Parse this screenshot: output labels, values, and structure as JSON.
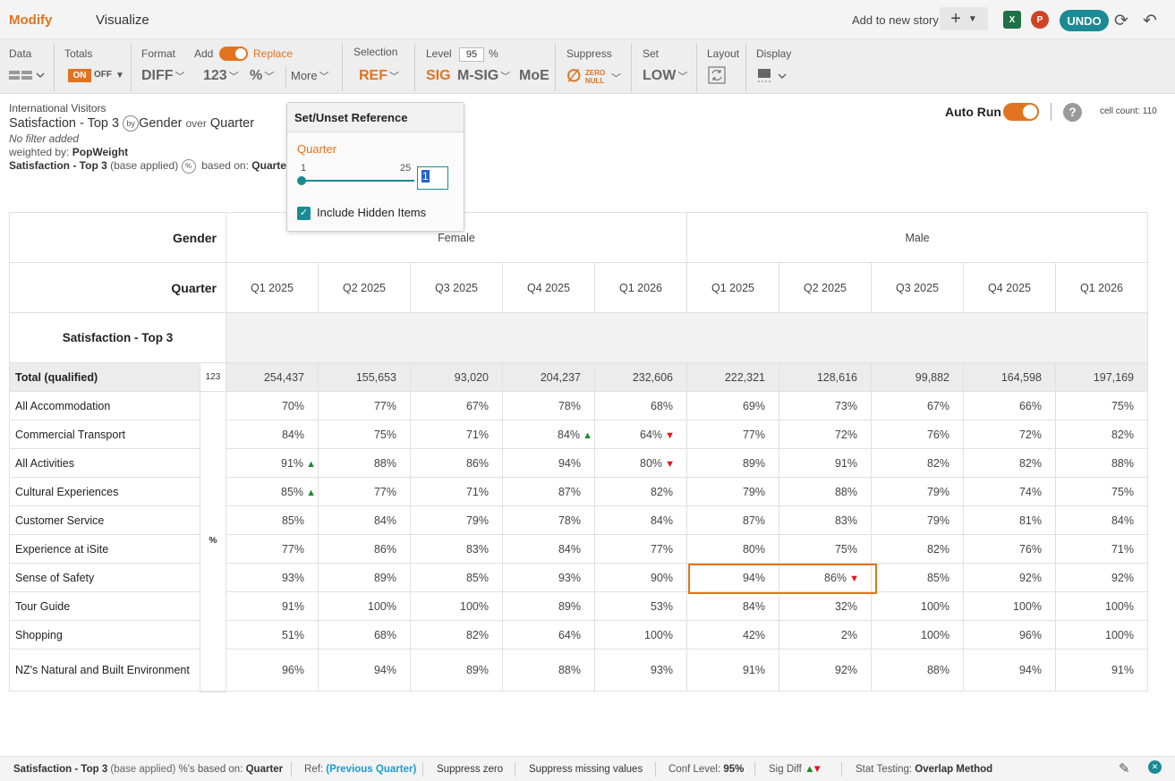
{
  "topbar": {
    "modify": "Modify",
    "visualize": "Visualize",
    "add_story": "Add to new story",
    "excel": "X",
    "ppt": "P",
    "undo": "UNDO"
  },
  "toolbar": {
    "data_label": "Data",
    "totals_label": "Totals",
    "totals_on": "ON",
    "totals_off": "OFF",
    "format_label": "Format",
    "add_label": "Add",
    "replace_label": "Replace",
    "diff": "DIFF",
    "n123": "123",
    "pct": "%",
    "more": "More",
    "selection_label": "Selection",
    "ref": "REF",
    "level_label": "Level",
    "level_value": "95",
    "level_pct": "%",
    "sig": "SIG",
    "msig": "M-SIG",
    "moe": "MoE",
    "suppress_label": "Suppress",
    "zero": "ZERO",
    "null": "NULL",
    "set_label": "Set",
    "low": "LOW",
    "layout_label": "Layout",
    "display_label": "Display"
  },
  "info": {
    "dataset": "International Visitors",
    "measure": "Satisfaction - Top 3",
    "by": "by",
    "gender": "Gender",
    "over": "over",
    "quarter": "Quarter",
    "filter": "No filter added",
    "weighted_prefix": "weighted by:",
    "weight": "PopWeight",
    "base_measure": "Satisfaction - Top 3",
    "base_applied": "(base applied)",
    "based_on": "based on:",
    "based_on_value": "Quarte"
  },
  "right": {
    "autorun": "Auto Run",
    "help": "?",
    "cellcount": "cell count: 110"
  },
  "popup": {
    "title": "Set/Unset Reference",
    "dimension": "Quarter",
    "min": "1",
    "max": "25",
    "value": "1",
    "include_hidden": "Include Hidden Items"
  },
  "table": {
    "gender_label": "Gender",
    "quarter_label": "Quarter",
    "measure_label": "Satisfaction - Top 3",
    "genders": [
      "Female",
      "Male"
    ],
    "quarters": [
      "Q1 2025",
      "Q2 2025",
      "Q3 2025",
      "Q4 2025",
      "Q1 2026",
      "Q1 2025",
      "Q2 2025",
      "Q3 2025",
      "Q4 2025",
      "Q1 2026"
    ],
    "total_label": "Total (qualified)",
    "total_tag": "123",
    "pct_tag": "%",
    "totals": [
      "254,437",
      "155,653",
      "93,020",
      "204,237",
      "232,606",
      "222,321",
      "128,616",
      "99,882",
      "164,598",
      "197,169"
    ],
    "rows": [
      {
        "label": "All Accommodation",
        "values": [
          "70%",
          "77%",
          "67%",
          "78%",
          "68%",
          "69%",
          "73%",
          "67%",
          "66%",
          "75%"
        ]
      },
      {
        "label": "Commercial Transport",
        "values": [
          "84%",
          "75%",
          "71%",
          "84%",
          "64%",
          "77%",
          "72%",
          "76%",
          "72%",
          "82%"
        ]
      },
      {
        "label": "All Activities",
        "values": [
          "91%",
          "88%",
          "86%",
          "94%",
          "80%",
          "89%",
          "91%",
          "82%",
          "82%",
          "88%"
        ]
      },
      {
        "label": "Cultural Experiences",
        "values": [
          "85%",
          "77%",
          "71%",
          "87%",
          "82%",
          "79%",
          "88%",
          "79%",
          "74%",
          "75%"
        ]
      },
      {
        "label": "Customer Service",
        "values": [
          "85%",
          "84%",
          "79%",
          "78%",
          "84%",
          "87%",
          "83%",
          "79%",
          "81%",
          "84%"
        ]
      },
      {
        "label": "Experience at iSite",
        "values": [
          "77%",
          "86%",
          "83%",
          "84%",
          "77%",
          "80%",
          "75%",
          "82%",
          "76%",
          "71%"
        ]
      },
      {
        "label": "Sense of Safety",
        "values": [
          "93%",
          "89%",
          "85%",
          "93%",
          "90%",
          "94%",
          "86%",
          "85%",
          "92%",
          "92%"
        ]
      },
      {
        "label": "Tour Guide",
        "values": [
          "91%",
          "100%",
          "100%",
          "89%",
          "53%",
          "84%",
          "32%",
          "100%",
          "100%",
          "100%"
        ]
      },
      {
        "label": "Shopping",
        "values": [
          "51%",
          "68%",
          "82%",
          "64%",
          "100%",
          "42%",
          "2%",
          "100%",
          "96%",
          "100%"
        ]
      },
      {
        "label": "NZ's Natural and Built Environment",
        "values": [
          "96%",
          "94%",
          "89%",
          "88%",
          "93%",
          "91%",
          "92%",
          "88%",
          "94%",
          "91%"
        ]
      }
    ],
    "sig_marks": [
      {
        "row": 1,
        "col": 3,
        "dir": "up"
      },
      {
        "row": 1,
        "col": 4,
        "dir": "down"
      },
      {
        "row": 2,
        "col": 0,
        "dir": "up"
      },
      {
        "row": 2,
        "col": 4,
        "dir": "down"
      },
      {
        "row": 3,
        "col": 0,
        "dir": "up"
      },
      {
        "row": 6,
        "col": 6,
        "dir": "down"
      }
    ]
  },
  "status": {
    "measure": "Satisfaction - Top 3",
    "base_applied": "(base applied)",
    "pct_based": "%'s based on:",
    "pct_based_value": "Quarter",
    "ref_label": "Ref:",
    "ref_value": "(Previous Quarter)",
    "suppress_zero": "Suppress zero",
    "suppress_missing": "Suppress missing values",
    "conf_label": "Conf Level:",
    "conf_value": "95%",
    "sigdiff": "Sig Diff",
    "stat_label": "Stat Testing:",
    "stat_value": "Overlap Method"
  },
  "colors": {
    "accent": "#e2731e",
    "teal": "#1a8a95",
    "up": "#1e8a2e",
    "down": "#e3141b"
  }
}
